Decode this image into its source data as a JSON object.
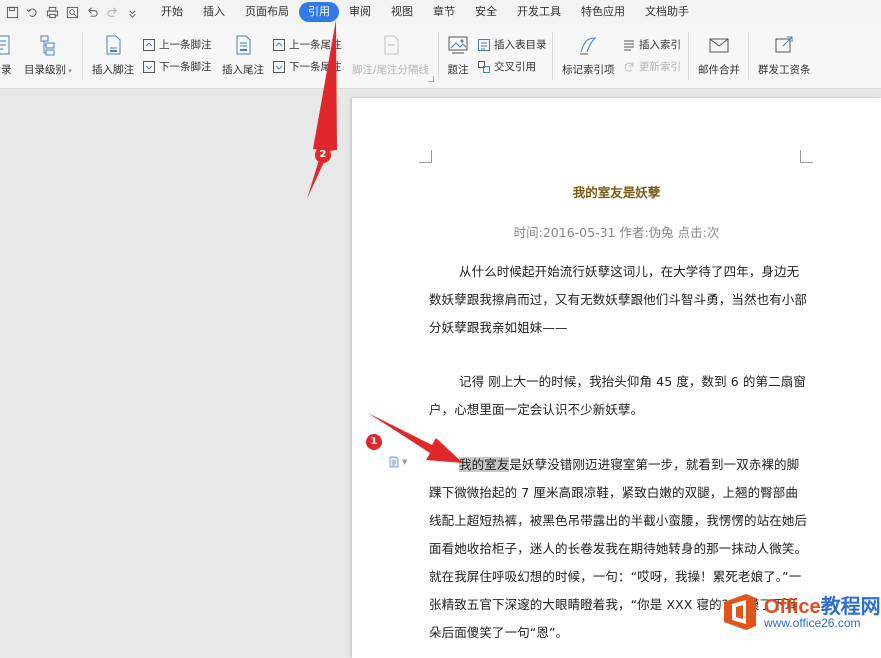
{
  "menubar": {
    "tabs": [
      "开始",
      "插入",
      "页面布局",
      "引用",
      "审阅",
      "视图",
      "章节",
      "安全",
      "开发工具",
      "特色应用",
      "文档助手"
    ],
    "active_tab": "引用",
    "quick_access_icons": [
      "save-icon",
      "revert-icon",
      "print-icon",
      "print-preview-icon",
      "undo-icon",
      "redo-icon",
      "customize-icon"
    ]
  },
  "ribbon": {
    "toc": "目录",
    "toc_level": "目录级别",
    "insert_footnote": "插入脚注",
    "prev_footnote": "上一条脚注",
    "next_footnote": "下一条脚注",
    "insert_endnote": "插入尾注",
    "prev_endnote": "上一条尾注",
    "next_endnote": "下一条尾注",
    "separator": "脚注/尾注分隔线",
    "caption": "题注",
    "insert_table_of_figures": "插入表目录",
    "cross_reference": "交叉引用",
    "mark_index_entry": "标记索引项",
    "insert_index": "插入索引",
    "update_index": "更新索引",
    "mail_merge": "邮件合并",
    "send_payroll": "群发工资条"
  },
  "document": {
    "title": "我的室友是妖孽",
    "meta": "时间:2016-05-31  作者:伪兔  点击:次",
    "paragraphs": [
      "从什么时候起开始流行妖孽这词儿，在大学待了四年，身边无数妖孽跟我擦肩而过，又有无数妖孽跟他们斗智斗勇，当然也有小部分妖孽跟我亲如姐妹——",
      "记得  刚上大一的时候，我抬头仰角 45 度，数到 6 的第二扇窗户，心想里面一定会认识不少新妖孽。"
    ],
    "para3_highlight": "我的室友",
    "para3_rest": "是妖孽没错刚迈进寝室第一步，就看到一双赤裸的脚踝下微微抬起的 7 厘米高跟凉鞋，紧致白嫩的双腿，上翘的臀部曲线配上超短热裤，被黑色吊带露出的半截小蛮腰，我愣愣的站在她后面看她收拾柜子，迷人的长卷发我在期待她转身的那一抹动人微笑。就在我屏住呼吸幻想的时候，一句：“哎呀，我操！累死老娘了。”一张精致五官下深邃的大眼睛瞪着我，“你是 XXX 寝的？我摸了下耳朵后面傻笑了一句“恩”。"
  },
  "annotations": {
    "badge1": "1",
    "badge2": "2"
  },
  "watermark": {
    "brand_main": "Office",
    "brand_tail": "教程网",
    "url": "www.office26.com"
  },
  "colors": {
    "active_tab_bg": "#2f7ae5",
    "arrow_red": "#e0272b",
    "title_brown": "#7b5b1a"
  }
}
